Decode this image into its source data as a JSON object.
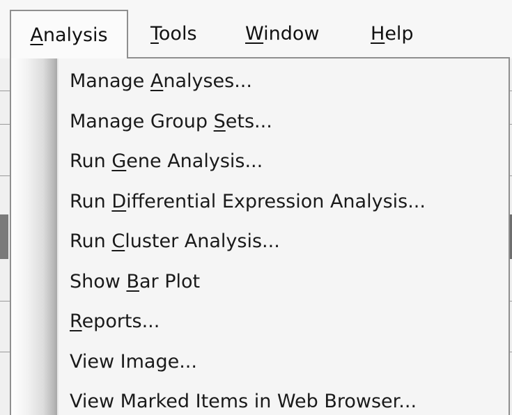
{
  "menubar": {
    "items": [
      {
        "pre": "",
        "key": "A",
        "post": "nalysis"
      },
      {
        "pre": "",
        "key": "T",
        "post": "ools"
      },
      {
        "pre": "",
        "key": "W",
        "post": "indow"
      },
      {
        "pre": "",
        "key": "H",
        "post": "elp"
      }
    ]
  },
  "menu": {
    "items": [
      {
        "pre": "Manage ",
        "key": "A",
        "post": "nalyses..."
      },
      {
        "pre": "Manage Group ",
        "key": "S",
        "post": "ets..."
      },
      {
        "pre": "Run ",
        "key": "G",
        "post": "ene Analysis..."
      },
      {
        "pre": "Run ",
        "key": "D",
        "post": "ifferential Expression Analysis..."
      },
      {
        "pre": "Run ",
        "key": "C",
        "post": "luster Analysis..."
      },
      {
        "pre": "Show ",
        "key": "B",
        "post": "ar Plot"
      },
      {
        "pre": "",
        "key": "R",
        "post": "eports..."
      },
      {
        "pre": "View Image...",
        "key": "",
        "post": ""
      },
      {
        "pre": "View Marked Items in Web Browser...",
        "key": "",
        "post": ""
      }
    ]
  }
}
